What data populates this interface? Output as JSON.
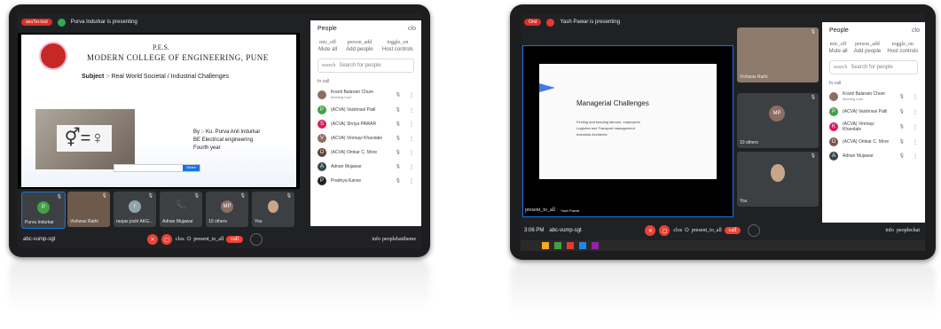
{
  "left": {
    "topbar": {
      "badge": "aeuTer.tout",
      "presenting": "Purva Indurkar is presenting"
    },
    "slide": {
      "logo_text": "P.E.S.",
      "college": "MODERN COLLEGE OF ENGINEERING, PUNE",
      "subject_label": "Subject",
      "subject": ":- Real World Societal / Industrial Challenges",
      "by": "By :- Ku. Purva Anil Indurkar",
      "dept": "BE Electrical engineering",
      "year": "Fourth year",
      "button": "Share"
    },
    "people": {
      "title": "People",
      "close": "clo",
      "controls": [
        {
          "icon": "mic_off",
          "label": "Mute all"
        },
        {
          "icon": "person_add",
          "label": "Add people"
        },
        {
          "icon": "toggle_on",
          "label": "Host controls"
        }
      ],
      "search_icon": "search",
      "search_placeholder": "Search for people",
      "in_call": "In call",
      "rows": [
        {
          "name": "Kranti Balaram Chure",
          "sub": "Meeting host",
          "color": "#8d6e63",
          "initial": ""
        },
        {
          "name": "(ACVA) Vaishnavi Patil",
          "sub": "",
          "color": "#43a047",
          "initial": "P"
        },
        {
          "name": "(ACVA) Shriya PAWAR",
          "sub": "",
          "color": "#d81b60",
          "initial": "S"
        },
        {
          "name": "(ACVA) Vinmayi Khandale",
          "sub": "",
          "color": "#8d6e63",
          "initial": "V"
        },
        {
          "name": "(ACVA) Omkar C. More",
          "sub": "",
          "color": "#5d4037",
          "initial": "O"
        },
        {
          "name": "Adnan Mujawar",
          "sub": "",
          "color": "#37474f",
          "initial": "A"
        },
        {
          "name": "Pradnya Kanse",
          "sub": "",
          "color": "#212121",
          "initial": "P"
        }
      ]
    },
    "tiles": [
      {
        "name": "Purva Indurkar",
        "initial": "P"
      },
      {
        "name": "Vishwas Rathi",
        "initial": ""
      },
      {
        "name": "raejas joshi AKG...",
        "initial": "r"
      },
      {
        "name": "Adnan Mujawar",
        "initial": ""
      },
      {
        "name": "10 others",
        "initial": "MP"
      },
      {
        "name": "You",
        "initial": ""
      }
    ],
    "bottom": {
      "meeting": "abc-vump-sgt",
      "words": "clos",
      "present": "present_to_all",
      "end": "call",
      "info": "info",
      "people": "peoplehat",
      "more": "theme"
    }
  },
  "right": {
    "topbar": {
      "badge": "Ond",
      "presenting": "Yash Pawar is presenting"
    },
    "slide": {
      "title": "Managerial Challenges",
      "bullets": [
        "Finding and keeping labours, employees",
        "Logistics and Transport management",
        "Industrial Accidents"
      ]
    },
    "present_label": "present_to_all",
    "presenter_name": "Yash Pawar",
    "people": {
      "title": "People",
      "close": "clo",
      "controls": [
        {
          "icon": "mic_off",
          "label": "Mute all"
        },
        {
          "icon": "person_add",
          "label": "Add people"
        },
        {
          "icon": "toggle_on",
          "label": "Host controls"
        }
      ],
      "search_icon": "search",
      "search_placeholder": "Search for people",
      "in_call": "In call",
      "rows": [
        {
          "name": "Kranti Balaram Chure",
          "sub": "Meeting host",
          "color": "#8d6e63",
          "initial": ""
        },
        {
          "name": "(ACVA) Vaishnavi Patil",
          "sub": "",
          "color": "#43a047",
          "initial": "P"
        },
        {
          "name": "(ACVA) Vinmayi Khandale",
          "sub": "",
          "color": "#d81b60",
          "initial": "K"
        },
        {
          "name": "(ACVA) Omkar C. More",
          "sub": "",
          "color": "#795548",
          "initial": "O"
        },
        {
          "name": "Adnan Mujawar",
          "sub": "",
          "color": "#37474f",
          "initial": "A"
        }
      ]
    },
    "tiles": [
      {
        "name": "Vishwas Rathi"
      },
      {
        "name": "10 others",
        "initial": "MP"
      },
      {
        "name": "You"
      }
    ],
    "bottom": {
      "time": "3:06 PM",
      "meeting": "abc-vump-sgt",
      "words": "clos",
      "present": "present_to_all",
      "end": "call",
      "info": "info",
      "people": "people",
      "more": "chat"
    }
  }
}
